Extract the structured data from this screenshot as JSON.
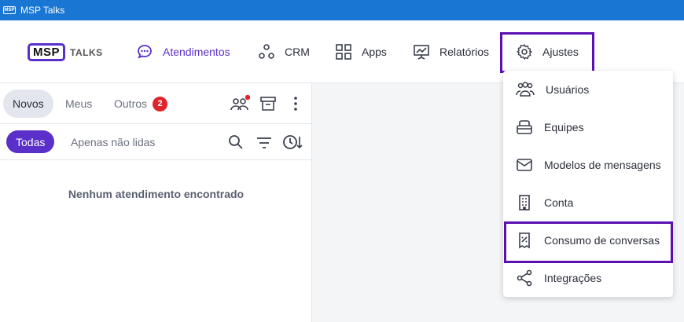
{
  "window": {
    "title": "MSP Talks",
    "logo_text": "MSP"
  },
  "brand": {
    "logo": "MSP",
    "suffix": "TALKS"
  },
  "nav": {
    "atendimentos": "Atendimentos",
    "crm": "CRM",
    "apps": "Apps",
    "relatorios": "Relatórios",
    "ajustes": "Ajustes"
  },
  "tabs": {
    "novos": "Novos",
    "meus": "Meus",
    "outros": "Outros",
    "outros_count": "2"
  },
  "filters": {
    "todas": "Todas",
    "apenas_nao_lidas": "Apenas não lidas"
  },
  "empty_state": "Nenhum atendimento encontrado",
  "dropdown": {
    "usuarios": "Usuários",
    "equipes": "Equipes",
    "modelos": "Modelos de mensagens",
    "conta": "Conta",
    "consumo": "Consumo de conversas",
    "integracoes": "Integrações"
  },
  "colors": {
    "brand": "#5b2fc9",
    "titlebar": "#1976d2",
    "badge": "#e0242a",
    "highlight": "#5b0fb3"
  }
}
